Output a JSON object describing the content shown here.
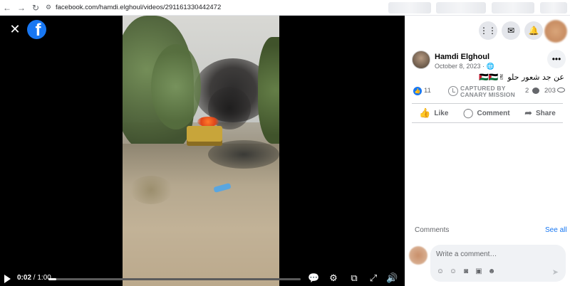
{
  "browser": {
    "url": "facebook.com/hamdi.elghoul/videos/291161330442472"
  },
  "video": {
    "time_current": "0:02",
    "time_separator": " / ",
    "time_total": "1:00",
    "progress_percent": 3
  },
  "panel": {
    "post": {
      "author": "Hamdi Elghoul",
      "date": "October 8, 2023 ·",
      "text": "عن جد شعور حلو ✌🇵🇸🇵🇸"
    },
    "stats": {
      "likes": "11",
      "canary_line1": "CAPTURED BY",
      "canary_line2": "CANARY MISSION",
      "comments": "2",
      "views": "203"
    },
    "actions": {
      "like": "Like",
      "comment": "Comment",
      "share": "Share"
    },
    "comments": {
      "label": "Comments",
      "see_all": "See all",
      "placeholder": "Write a comment…"
    }
  },
  "colors": {
    "brand": "#1877f2",
    "video_bg": "#000000"
  }
}
